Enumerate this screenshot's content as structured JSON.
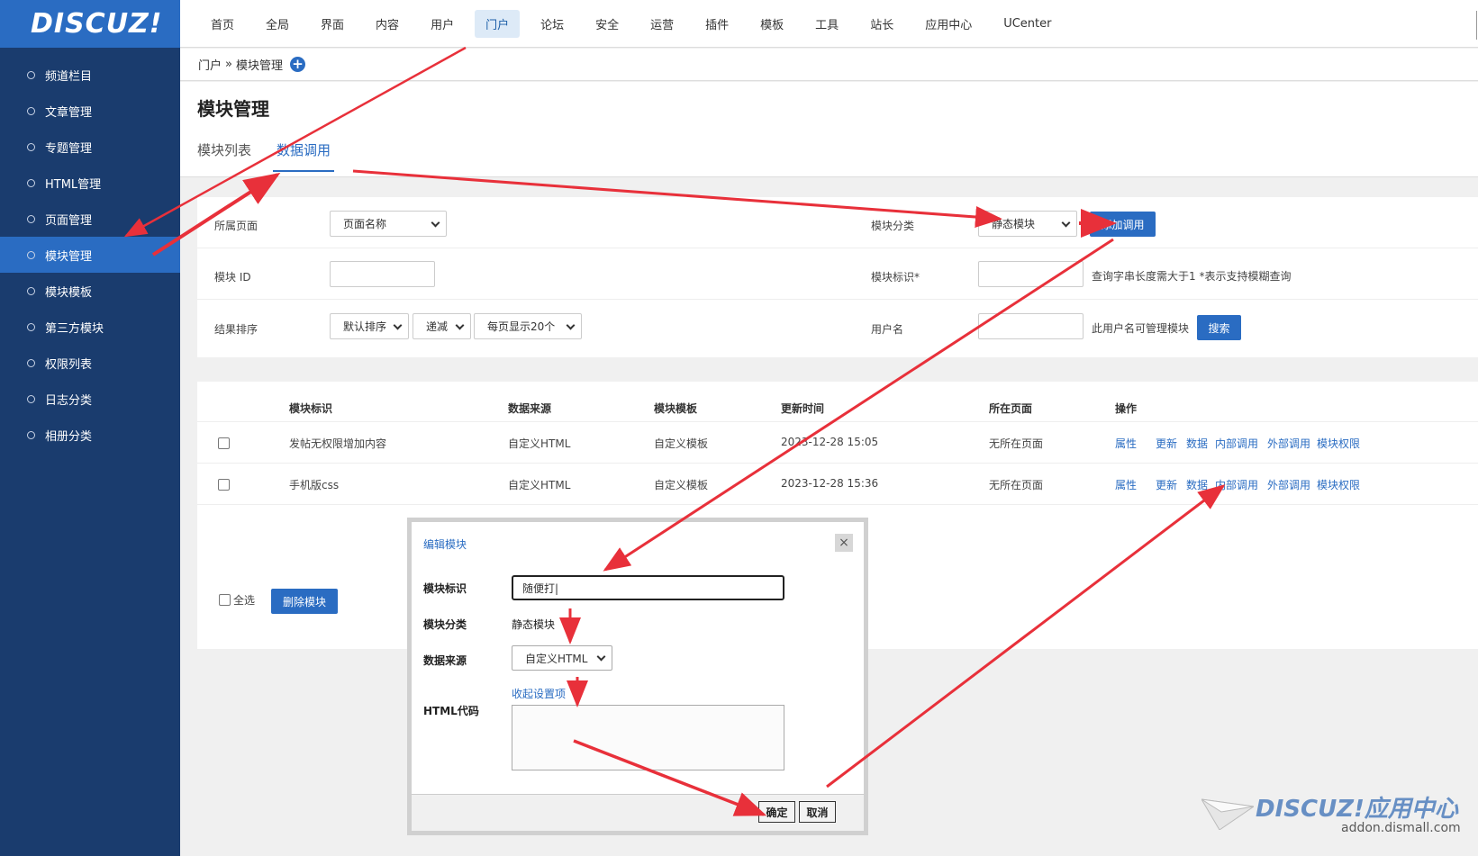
{
  "logo": "DISCUZ!",
  "sidebar": {
    "items": [
      {
        "label": "频道栏目"
      },
      {
        "label": "文章管理"
      },
      {
        "label": "专题管理"
      },
      {
        "label": "HTML管理"
      },
      {
        "label": "页面管理"
      },
      {
        "label": "模块管理"
      },
      {
        "label": "模块模板"
      },
      {
        "label": "第三方模块"
      },
      {
        "label": "权限列表"
      },
      {
        "label": "日志分类"
      },
      {
        "label": "相册分类"
      }
    ],
    "active_index": 5
  },
  "topnav": {
    "items": [
      "首页",
      "全局",
      "界面",
      "内容",
      "用户",
      "门户",
      "论坛",
      "安全",
      "运营",
      "插件",
      "模板",
      "工具",
      "站长",
      "应用中心",
      "UCenter"
    ],
    "active_index": 5
  },
  "breadcrumb": {
    "parent": "门户",
    "separator": "»",
    "current": "模块管理"
  },
  "page": {
    "title": "模块管理"
  },
  "tabs": [
    "模块列表",
    "数据调用"
  ],
  "filter": {
    "page_label": "所属页面",
    "page_select": "页面名称",
    "category_label": "模块分类",
    "category_select": "静态模块",
    "add_button": "添加调用",
    "id_label": "模块 ID",
    "ident_label": "模块标识*",
    "ident_hint": "查询字串长度需大于1  *表示支持模糊查询",
    "sort_label": "结果排序",
    "sort_select": "默认排序",
    "order_select": "递减",
    "perpage_select": "每页显示20个",
    "user_label": "用户名",
    "user_hint": "此用户名可管理模块",
    "search_button": "搜索"
  },
  "table": {
    "headers": [
      "模块标识",
      "数据来源",
      "模块模板",
      "更新时间",
      "所在页面",
      "操作"
    ],
    "rows": [
      {
        "ident": "发帖无权限增加内容",
        "source": "自定义HTML",
        "template": "自定义模板",
        "time": "2023-12-28 15:05",
        "page": "无所在页面"
      },
      {
        "ident": "手机版css",
        "source": "自定义HTML",
        "template": "自定义模板",
        "time": "2023-12-28 15:36",
        "page": "无所在页面"
      }
    ],
    "ops": [
      "属性",
      "更新",
      "数据",
      "内部调用",
      "外部调用",
      "模块权限"
    ],
    "select_all": "全选",
    "delete_button": "删除模块"
  },
  "dialog": {
    "title": "编辑模块",
    "close": "×",
    "ident_label": "模块标识",
    "ident_value": "随便打|",
    "category_label": "模块分类",
    "category_value": "静态模块",
    "source_label": "数据来源",
    "source_value": "自定义HTML",
    "toggle_link": "收起设置项",
    "html_label": "HTML代码",
    "confirm": "确定",
    "cancel": "取消"
  },
  "watermark": {
    "main": "DISCUZ!应用中心",
    "sub": "addon.dismall.com"
  },
  "colors": {
    "sidebar": "#1a3c6e",
    "accent": "#2a6cc2",
    "arrow": "#e8303a"
  }
}
